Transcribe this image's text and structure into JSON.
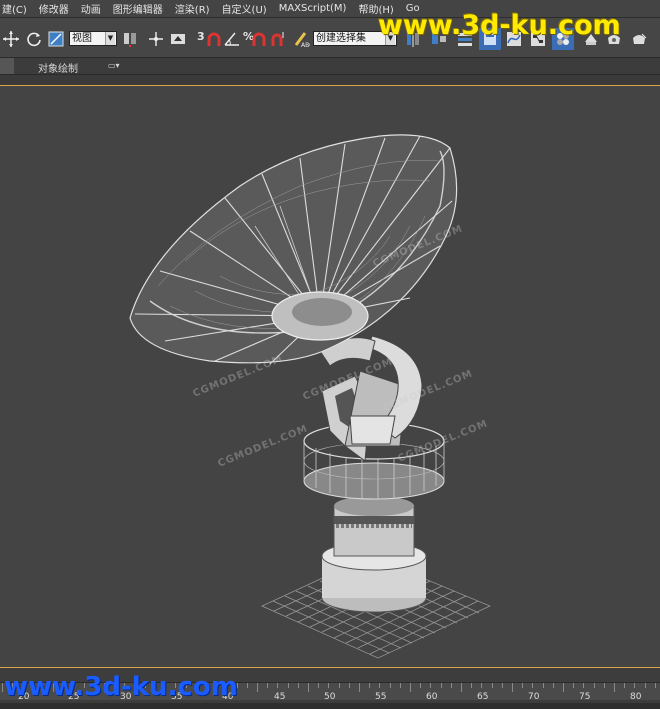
{
  "menu": {
    "items": [
      "建(C)",
      "修改器",
      "动画",
      "图形编辑器",
      "渲染(R)",
      "自定义(U)",
      "MAXScript(M)",
      "帮助(H)",
      "Go"
    ]
  },
  "toolbar": {
    "view_dropdown": "视图",
    "selection_set_dropdown": "创建选择集",
    "snap_3_label": "3",
    "snap_percent_label": "%"
  },
  "ribbon": {
    "tab_object_paint": "对象绘制"
  },
  "timeline": {
    "labels": [
      "45",
      "50",
      "55",
      "60",
      "65",
      "70",
      "75",
      "80"
    ],
    "partial_labels": [
      "20",
      "25",
      "30",
      "35",
      "40"
    ]
  },
  "watermark": {
    "top": "www.3d-ku.com",
    "bottom": "www.3d-ku.com",
    "faint": "CGMODEL.COM"
  },
  "colors": {
    "viewport_bg": "#444444",
    "viewport_border": "#d9a54a",
    "watermark_top": "#ffea00",
    "watermark_bottom": "#1a5cff"
  }
}
